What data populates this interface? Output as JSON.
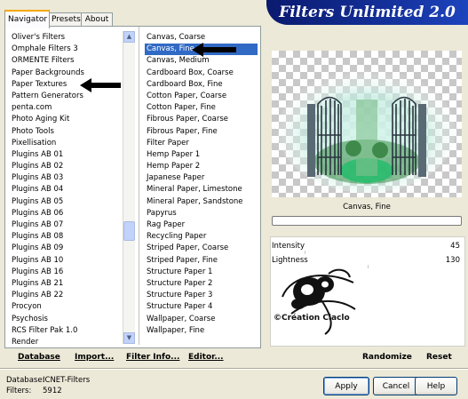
{
  "banner": {
    "title": "Filters Unlimited 2.0"
  },
  "tabs": [
    {
      "label": "Navigator",
      "active": true
    },
    {
      "label": "Presets",
      "active": false
    },
    {
      "label": "About",
      "active": false
    }
  ],
  "categories": [
    "Oliver's Filters",
    "Omphale Filters 3",
    "ORMENTE Filters",
    "Paper Backgrounds",
    "Paper Textures",
    "Pattern Generators",
    "penta.com",
    "Photo Aging Kit",
    "Photo Tools",
    "Pixellisation",
    "Plugins AB 01",
    "Plugins AB 02",
    "Plugins AB 03",
    "Plugins AB 04",
    "Plugins AB 05",
    "Plugins AB 06",
    "Plugins AB 07",
    "Plugins AB 08",
    "Plugins AB 09",
    "Plugins AB 10",
    "Plugins AB 16",
    "Plugins AB 21",
    "Plugins AB 22",
    "Procyon",
    "Psychosis",
    "RCS Filter Pak 1.0",
    "Render"
  ],
  "filters": [
    "Canvas, Coarse",
    "Canvas, Fine",
    "Canvas, Medium",
    "Cardboard Box, Coarse",
    "Cardboard Box, Fine",
    "Cotton Paper, Coarse",
    "Cotton Paper, Fine",
    "Fibrous Paper, Coarse",
    "Fibrous Paper, Fine",
    "Filter Paper",
    "Hemp Paper 1",
    "Hemp Paper 2",
    "Japanese Paper",
    "Mineral Paper, Limestone",
    "Mineral Paper, Sandstone",
    "Papyrus",
    "Rag Paper",
    "Recycling Paper",
    "Striped Paper, Coarse",
    "Striped Paper, Fine",
    "Structure Paper 1",
    "Structure Paper 2",
    "Structure Paper 3",
    "Structure Paper 4",
    "Wallpaper, Coarse",
    "Wallpaper, Fine"
  ],
  "selected_filter_index": 1,
  "preview": {
    "filter_name": "Canvas, Fine"
  },
  "params": [
    {
      "label": "Intensity",
      "value": "45"
    },
    {
      "label": "Lightness",
      "value": "130"
    }
  ],
  "watermark": "©Création Claclo",
  "links": {
    "database": "Database",
    "import": "Import...",
    "filter_info": "Filter Info...",
    "editor": "Editor..."
  },
  "actions": {
    "randomize": "Randomize",
    "reset": "Reset"
  },
  "status": {
    "database_label": "Database:",
    "database_value": "ICNET-Filters",
    "filters_label": "Filters:",
    "filters_value": "5912"
  },
  "buttons": {
    "apply": "Apply",
    "cancel": "Cancel",
    "help": "Help"
  },
  "colors": {
    "selection": "#316ac5",
    "banner": "#14309a",
    "tab_accent": "#f7a800"
  }
}
